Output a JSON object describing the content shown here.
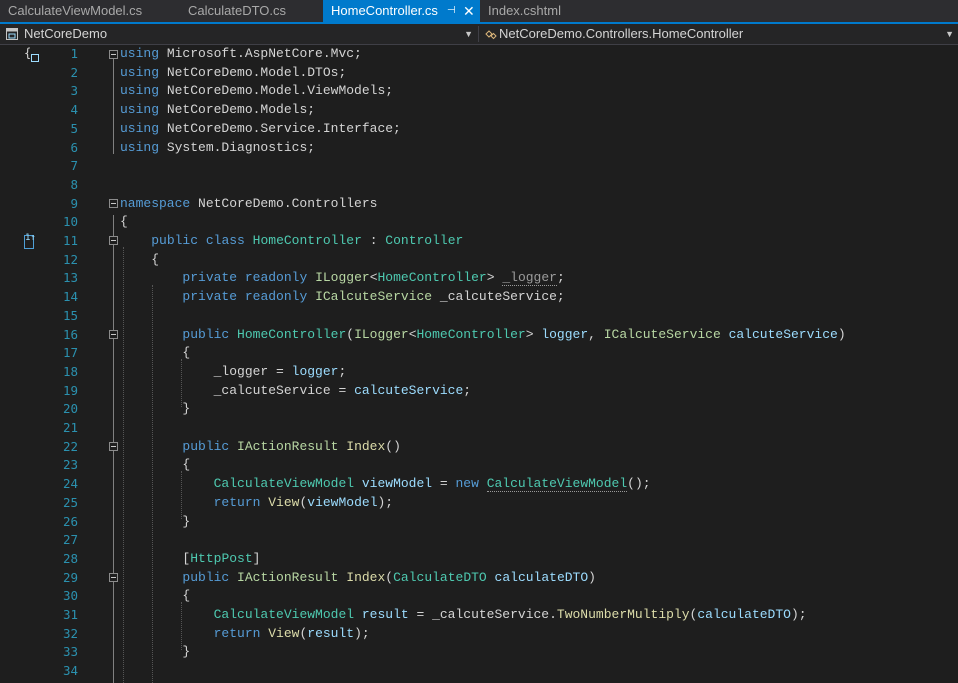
{
  "tabs": [
    {
      "label": "CalculateViewModel.cs",
      "active": false
    },
    {
      "label": "CalculateDTO.cs",
      "active": false
    },
    {
      "label": "HomeController.cs",
      "active": true,
      "pin_glyph": "⊣",
      "close_glyph": "✕"
    },
    {
      "label": "Index.cshtml",
      "active": false
    }
  ],
  "navbar": {
    "project": "NetCoreDemo",
    "type": "NetCoreDemo.Controllers.HomeController",
    "dropdown_glyph": "▼"
  },
  "gutter": {
    "brace_glyph": "{",
    "line11_marker": "1↑"
  },
  "code": {
    "l1": {
      "n": "1",
      "kw": "using",
      "rest": " Microsoft.AspNetCore.Mvc;"
    },
    "l2": {
      "n": "2",
      "kw": "using",
      "rest": " NetCoreDemo.Model.DTOs;"
    },
    "l3": {
      "n": "3",
      "kw": "using",
      "rest": " NetCoreDemo.Model.ViewModels;"
    },
    "l4": {
      "n": "4",
      "kw": "using",
      "rest": " NetCoreDemo.Models;"
    },
    "l5": {
      "n": "5",
      "kw": "using",
      "rest": " NetCoreDemo.Service.Interface;"
    },
    "l6": {
      "n": "6",
      "kw": "using",
      "rest": " System.Diagnostics;"
    },
    "l7": {
      "n": "7"
    },
    "l8": {
      "n": "8"
    },
    "l9": {
      "n": "9",
      "kw": "namespace",
      "rest": " NetCoreDemo.Controllers"
    },
    "l10": {
      "n": "10",
      "a": "{"
    },
    "l11": {
      "n": "11",
      "kw1": "public",
      "kw2": "class",
      "cls": "HomeController",
      "colon": " : ",
      "base": "Controller"
    },
    "l12": {
      "n": "12",
      "a": "{"
    },
    "l13": {
      "n": "13",
      "kw1": "private",
      "kw2": "readonly",
      "itf": "ILogger",
      "lt": "<",
      "ty": "HomeController",
      "gt": ">",
      "sp": " ",
      "fld": "_logger",
      "end": ";"
    },
    "l14": {
      "n": "14",
      "kw1": "private",
      "kw2": "readonly",
      "itf": "ICalcuteService",
      "fld": " _calcuteService;"
    },
    "l15": {
      "n": "15"
    },
    "l16": {
      "n": "16",
      "kw": "public",
      "ctor": "HomeController",
      "p1": "(",
      "itf1": "ILogger",
      "lt": "<",
      "ty": "HomeController",
      "gt": ">",
      "prm1": " logger",
      "comma": ", ",
      "itf2": "ICalcuteService",
      "prm2": " calcuteService",
      "p2": ")"
    },
    "l17": {
      "n": "17",
      "a": "{"
    },
    "l18": {
      "n": "18",
      "fld": "_logger",
      "eq": " = ",
      "val": "logger",
      "end": ";"
    },
    "l19": {
      "n": "19",
      "fld": "_calcuteService",
      "eq": " = ",
      "val": "calcuteService",
      "end": ";"
    },
    "l20": {
      "n": "20",
      "a": "}"
    },
    "l21": {
      "n": "21"
    },
    "l22": {
      "n": "22",
      "kw": "public",
      "itf": "IActionResult",
      "fn": "Index",
      "end": "()"
    },
    "l23": {
      "n": "23",
      "a": "{"
    },
    "l24": {
      "n": "24",
      "ty": "CalculateViewModel",
      "var": " viewModel",
      "eq": " = ",
      "kw": "new",
      "sp": " ",
      "ty2": "CalculateViewModel",
      "end": "();"
    },
    "l25": {
      "n": "25",
      "kw": "return",
      "fn": "View",
      "p1": "(",
      "var": "viewModel",
      "p2": ");"
    },
    "l26": {
      "n": "26",
      "a": "}"
    },
    "l27": {
      "n": "27"
    },
    "l28": {
      "n": "28",
      "b1": "[",
      "attr": "HttpPost",
      "b2": "]"
    },
    "l29": {
      "n": "29",
      "kw": "public",
      "itf": "IActionResult",
      "fn": "Index",
      "p1": "(",
      "ty": "CalculateDTO",
      "prm": " calculateDTO",
      "p2": ")"
    },
    "l30": {
      "n": "30",
      "a": "{"
    },
    "l31": {
      "n": "31",
      "ty": "CalculateViewModel",
      "var": " result",
      "eq": " = ",
      "fld": "_calcuteService.",
      "fn": "TwoNumberMultiply",
      "p1": "(",
      "prm": "calculateDTO",
      "p2": ");"
    },
    "l32": {
      "n": "32",
      "kw": "return",
      "fn": "View",
      "p1": "(",
      "var": "result",
      "p2": ");"
    },
    "l33": {
      "n": "33",
      "a": "}"
    },
    "l34": {
      "n": "34"
    }
  }
}
